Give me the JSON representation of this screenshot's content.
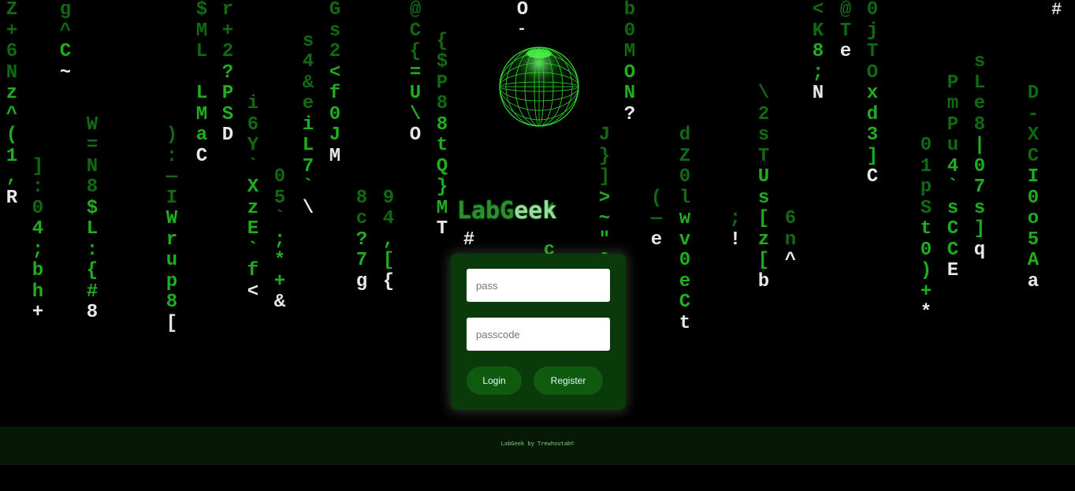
{
  "colors": {
    "background": "#000000",
    "rain_green": "#1fae1f",
    "rain_dim": "#116a11",
    "rain_head": "#e8e8e8",
    "card_bg": "#0a3a0a",
    "button_bg": "#0f5a0f"
  },
  "brand": {
    "title_dark": "LabG",
    "title_light": "eek"
  },
  "login": {
    "pass_placeholder": "pass",
    "passcode_placeholder": "passcode",
    "login_label": "Login",
    "register_label": "Register"
  },
  "footer": {
    "credit": "LabGeek by Trewhoutab©"
  },
  "decor": {
    "corner": "#",
    "top_dash": "-"
  },
  "rain_columns": [
    {
      "chars": "Z+6Nz^(1,R",
      "start": 0
    },
    {
      "chars": "]:04;bh+",
      "start": 15
    },
    {
      "chars": "g^C~",
      "start": 0
    },
    {
      "chars": "W=N8$L:{#8",
      "start": 11
    },
    {
      "chars": "):—IWrup8[",
      "start": 12
    },
    {
      "chars": "$ML LMaC",
      "start": 0
    },
    {
      "chars": "r+2?PSD",
      "start": 0
    },
    {
      "chars": "i6Y`XzE`f<",
      "start": 9
    },
    {
      "chars": "05`;*+&",
      "start": 16
    },
    {
      "chars": "s4&eiL7`\\",
      "start": 3
    },
    {
      "chars": "Gs2<f0JM",
      "start": 0
    },
    {
      "chars": "8c?7g",
      "start": 18
    },
    {
      "chars": "94,[{",
      "start": 18
    },
    {
      "chars": "@C{=U\\O",
      "start": 0
    },
    {
      "chars": "{$P88tQ}MT",
      "start": 3
    },
    {
      "chars": "#",
      "start": 22
    },
    {
      "chars": "O",
      "start": 0
    },
    {
      "chars": "J}]>~\"&2",
      "start": 12
    },
    {
      "chars": "x c0@",
      "start": 19
    },
    {
      "chars": "b0MON?",
      "start": 0
    },
    {
      "chars": "(—e",
      "start": 18
    },
    {
      "chars": "dZ0lwv0eCt",
      "start": 12
    },
    {
      "chars": ";!",
      "start": 20
    },
    {
      "chars": "\\2sTUs[z[b",
      "start": 8
    },
    {
      "chars": "6n^",
      "start": 20
    },
    {
      "chars": "<K8;N",
      "start": 0
    },
    {
      "chars": "@Te",
      "start": 0
    },
    {
      "chars": "0jTOxd3]C",
      "start": 0
    },
    {
      "chars": "01pSt0)+*",
      "start": 13
    },
    {
      "chars": "PmPu4`sCCE",
      "start": 7
    },
    {
      "chars": "sLe8|07s]q",
      "start": 5
    },
    {
      "chars": "D-XCI0o5Aa",
      "start": 8
    }
  ]
}
